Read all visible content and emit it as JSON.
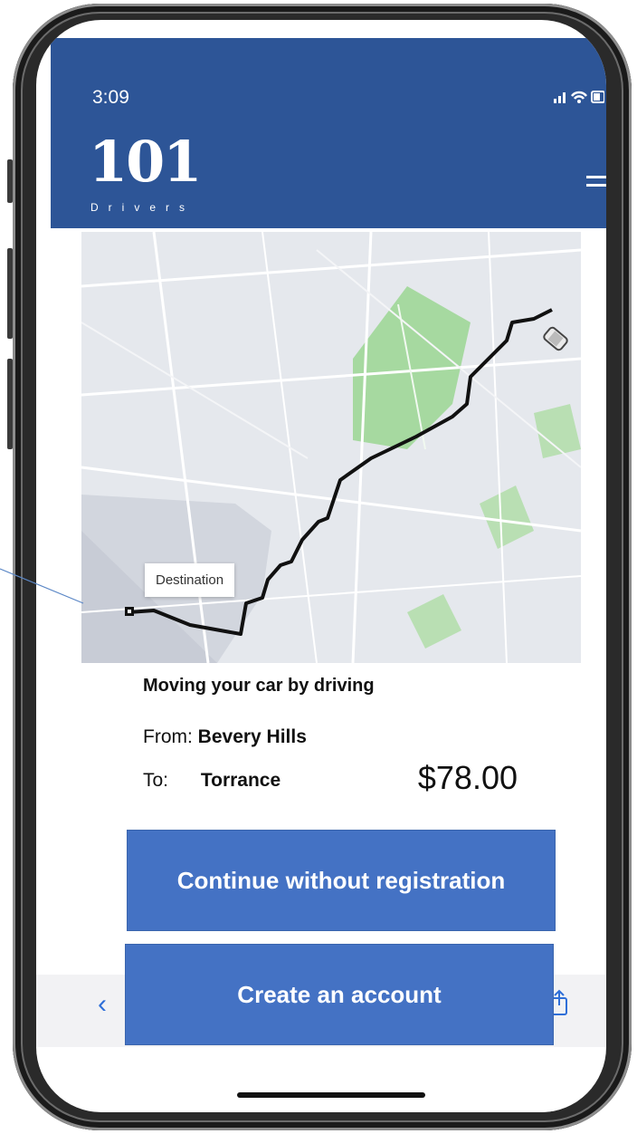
{
  "status_bar": {
    "time": "3:09",
    "indicators": "signal-wifi-battery"
  },
  "brand": {
    "logo_number": "101",
    "logo_subtitle": "Drivers",
    "color": "#2d5597"
  },
  "map": {
    "destination_label": "Destination"
  },
  "trip": {
    "title": "Moving your car by driving",
    "from_label": "From:",
    "from_value": "Bevery Hills",
    "to_label": "To:",
    "to_value": "Torrance",
    "price": "$78.00"
  },
  "actions": {
    "continue_label": "Continue without registration",
    "create_label": "Create an account",
    "button_color": "#4472c4"
  },
  "browser": {
    "back_icon": "chevron-left-icon",
    "share_icon": "share-icon"
  }
}
